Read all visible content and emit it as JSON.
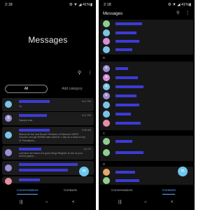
{
  "left": {
    "status": {
      "time": "2:18",
      "icons": "⚙ ▼ ◢ 41%▮"
    },
    "title": "Messages",
    "tabs": {
      "all": "All",
      "add": "Add category"
    },
    "conversations": [
      {
        "initial": "",
        "avatar_color": "#7bc4e8",
        "time": "5:11 PM",
        "preview": "Yo"
      },
      {
        "initial": "B",
        "avatar_color": "#9b8ed6",
        "time": "5:11 PM",
        "preview": "Sample sms"
      },
      {
        "initial": "",
        "avatar_color": "#7bc4e8",
        "time": "5:08 AM",
        "preview": "Wanna be the next Boost? Redeem a Pokemon UNITE Voucher and get 500MB data valid for 1 day for a total of only 11 Pesoakonu..."
      },
      {
        "initial": "",
        "avatar_color": "#9b8ed6",
        "time": "Jun 20",
        "preview": "Last time we heard of a good Mega Register is one of your recent payme..."
      },
      {
        "initial": "",
        "avatar_color": "#9b8ed6",
        "time": "",
        "preview": ""
      },
      {
        "initial": "",
        "avatar_color": "#e58fa3",
        "time": "",
        "preview": ""
      }
    ],
    "nav": {
      "conversations": "Conversations",
      "contacts": "Contacts"
    },
    "sysnav": {
      "recent": "|||",
      "home": "○",
      "back": "<"
    }
  },
  "right": {
    "status": {
      "time": "2:18",
      "icons": "⚙ ▼ ◢ 41%▮"
    },
    "title": "Messages",
    "letters": [
      "B",
      "C",
      "D"
    ],
    "contacts": [
      {
        "initial": "",
        "color": "#8fcf8f"
      },
      {
        "initial": "",
        "color": "#7bc4e8"
      },
      {
        "initial": "",
        "color": "#d68fd6"
      },
      {
        "initial": "",
        "color": "#7bc4e8"
      },
      {
        "initial": "B",
        "color": "#9b8ed6"
      },
      {
        "initial": "B",
        "color": "#d68fd6"
      },
      {
        "initial": "B",
        "color": "#7bc4e8"
      },
      {
        "initial": "B",
        "color": "#9b8ed6"
      },
      {
        "initial": "",
        "color": "#7bc4e8"
      },
      {
        "initial": "",
        "color": "#7bc4e8"
      },
      {
        "initial": "",
        "color": "#e58fa3"
      },
      {
        "initial": "",
        "color": "#8fcf8f"
      },
      {
        "initial": "",
        "color": "#8fcf8f"
      },
      {
        "initial": "",
        "color": "#e5a86a"
      },
      {
        "initial": "",
        "color": "#8fcf8f"
      }
    ],
    "nav": {
      "conversations": "Conversations",
      "contacts": "Contacts"
    },
    "sysnav": {
      "recent": "|||",
      "home": "○",
      "back": "<"
    }
  }
}
